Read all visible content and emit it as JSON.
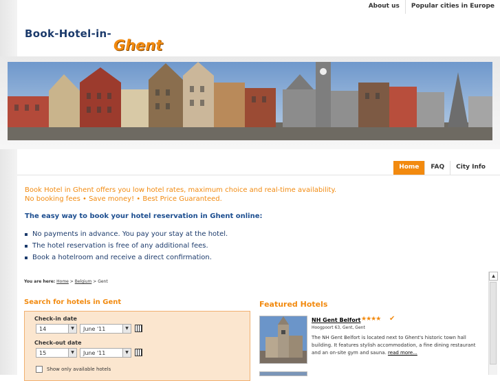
{
  "topnav": {
    "about": "About us",
    "popular": "Popular cities in Europe"
  },
  "logo": {
    "main": "Book-Hotel-in-",
    "city": "Ghent"
  },
  "mainnav": [
    {
      "label": "Home"
    },
    {
      "label": "FAQ"
    },
    {
      "label": "City Info"
    }
  ],
  "intro": {
    "line1": "Book Hotel in Ghent offers you low hotel rates, maximum choice and real-time availability.",
    "line2": "No booking fees • Save money! • Best Price Guaranteed."
  },
  "headline": "The easy way to book your hotel reservation in Ghent online:",
  "bullets": [
    "No payments in advance. You pay your stay at the hotel.",
    "The hotel reservation is free of any additional fees.",
    "Book a hotelroom and receive a direct confirmation."
  ],
  "breadcrumb": {
    "prefix": "You are here:",
    "home": "Home",
    "sep1": ">",
    "country": "Belgium",
    "sep2": ">",
    "current": "Gent"
  },
  "search": {
    "title": "Search for hotels in Gent",
    "checkin_label": "Check-in date",
    "checkin_day": "14",
    "checkin_month": "June '11",
    "checkout_label": "Check-out date",
    "checkout_day": "15",
    "checkout_month": "June '11",
    "available_only": "Show only available hotels"
  },
  "featured": {
    "title": "Featured Hotels",
    "hotels": [
      {
        "name": "NH Gent Belfort",
        "stars": "★★★★",
        "check": "✔",
        "address": "Hoogpoort 63, Gent, Gent",
        "description": "The NH Gent Belfort is located next to Ghent's historic town hall building. It features stylish accommodation, a fine dining restaurant and an on-site gym and sauna.",
        "more": "read more..."
      }
    ]
  },
  "colors": {
    "accent": "#f28a0f",
    "brand_blue": "#1b3a6b"
  }
}
